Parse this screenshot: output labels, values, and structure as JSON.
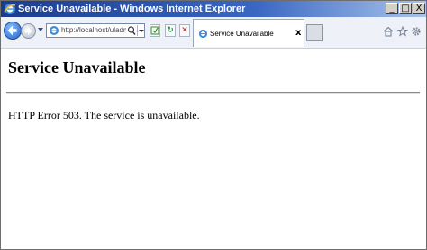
{
  "window": {
    "title": "Service Unavailable - Windows Internet Explorer",
    "controls": {
      "minimize": "_",
      "maximize": "□",
      "close": "X"
    }
  },
  "navbar": {
    "address": {
      "value": "http://localhost/uladmin",
      "search_icon": "magnifier-icon",
      "dropdown_icon": "chevron-down-icon"
    },
    "buttons": {
      "compat": "compatibility-view-icon",
      "refresh": "↻",
      "stop": "✕"
    },
    "tab": {
      "title": "Service Unavailable",
      "close": "x"
    },
    "right_icons": [
      "home-icon",
      "favorites-star-icon",
      "tools-gear-icon"
    ]
  },
  "page": {
    "heading": "Service Unavailable",
    "message": "HTTP Error 503. The service is unavailable."
  },
  "colors": {
    "titlebar_start": "#1a3c8e",
    "titlebar_end": "#a9c4ea",
    "navbar_bg": "#eef2f8"
  }
}
